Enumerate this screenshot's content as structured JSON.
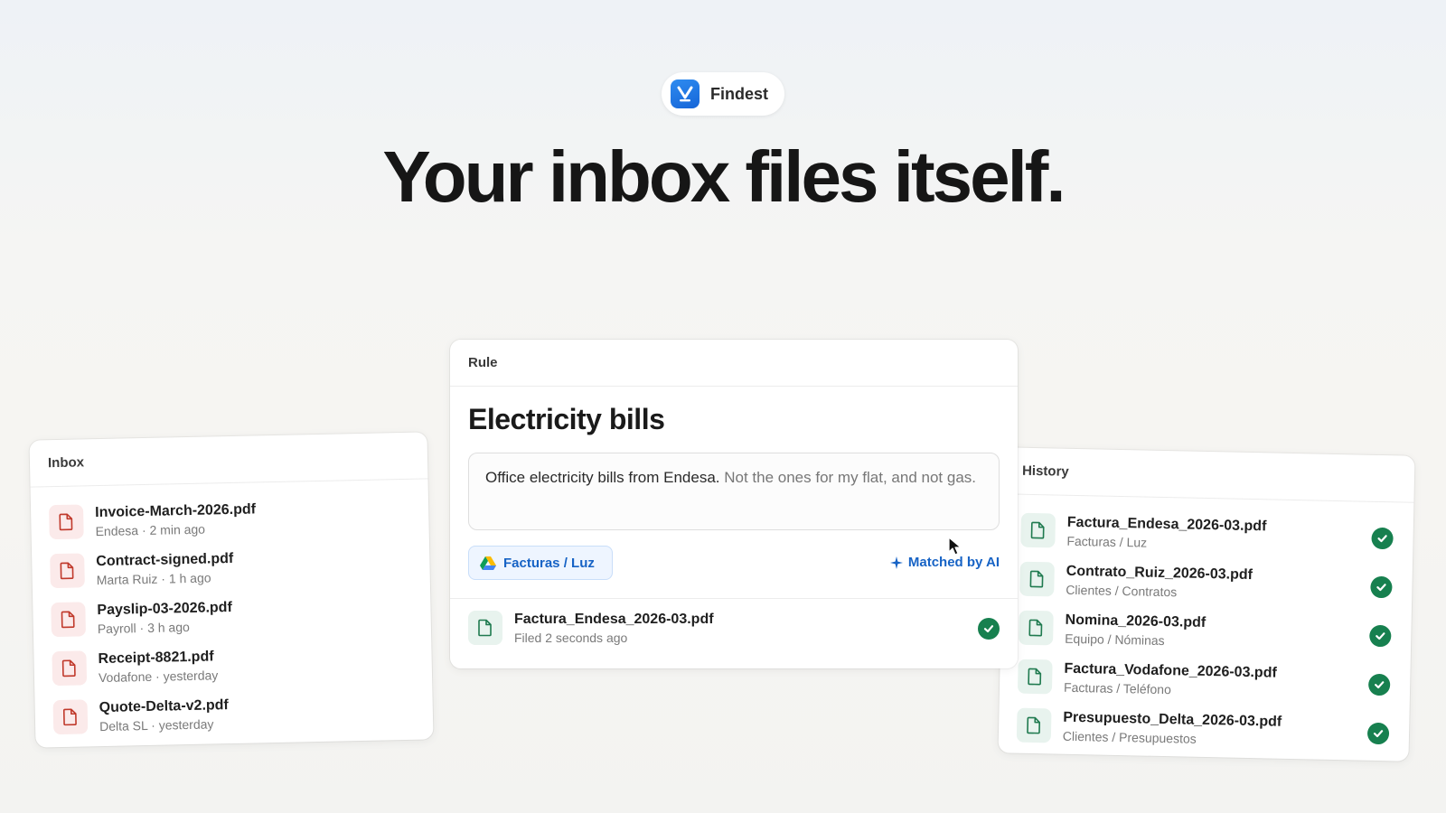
{
  "brand": {
    "name": "Findest"
  },
  "headline": "Your inbox files itself.",
  "inbox": {
    "title": "Inbox",
    "items": [
      {
        "name": "Invoice-March-2026.pdf",
        "meta": "Endesa · 2 min ago"
      },
      {
        "name": "Contract-signed.pdf",
        "meta": "Marta Ruiz · 1 h ago"
      },
      {
        "name": "Payslip-03-2026.pdf",
        "meta": "Payroll · 3 h ago"
      },
      {
        "name": "Receipt-8821.pdf",
        "meta": "Vodafone · yesterday"
      },
      {
        "name": "Quote-Delta-v2.pdf",
        "meta": "Delta SL · yesterday"
      }
    ]
  },
  "rule": {
    "header": "Rule",
    "title": "Electricity bills",
    "description_main": "Office electricity bills from Endesa.",
    "description_aside": "Not the ones for my flat, and not gas.",
    "destination": "Facturas / Luz",
    "matched_label": "Matched by AI",
    "result": {
      "name": "Factura_Endesa_2026-03.pdf",
      "meta": "Filed 2 seconds ago"
    }
  },
  "history": {
    "title": "History",
    "items": [
      {
        "name": "Factura_Endesa_2026-03.pdf",
        "meta": "Facturas / Luz"
      },
      {
        "name": "Contrato_Ruiz_2026-03.pdf",
        "meta": "Clientes / Contratos"
      },
      {
        "name": "Nomina_2026-03.pdf",
        "meta": "Equipo / Nóminas"
      },
      {
        "name": "Factura_Vodafone_2026-03.pdf",
        "meta": "Facturas / Teléfono"
      },
      {
        "name": "Presupuesto_Delta_2026-03.pdf",
        "meta": "Clientes / Presupuestos"
      }
    ]
  },
  "colors": {
    "accent_blue": "#1763c5",
    "success_green": "#17804f",
    "file_red": "#c0392b",
    "file_green": "#1f7a4f"
  }
}
